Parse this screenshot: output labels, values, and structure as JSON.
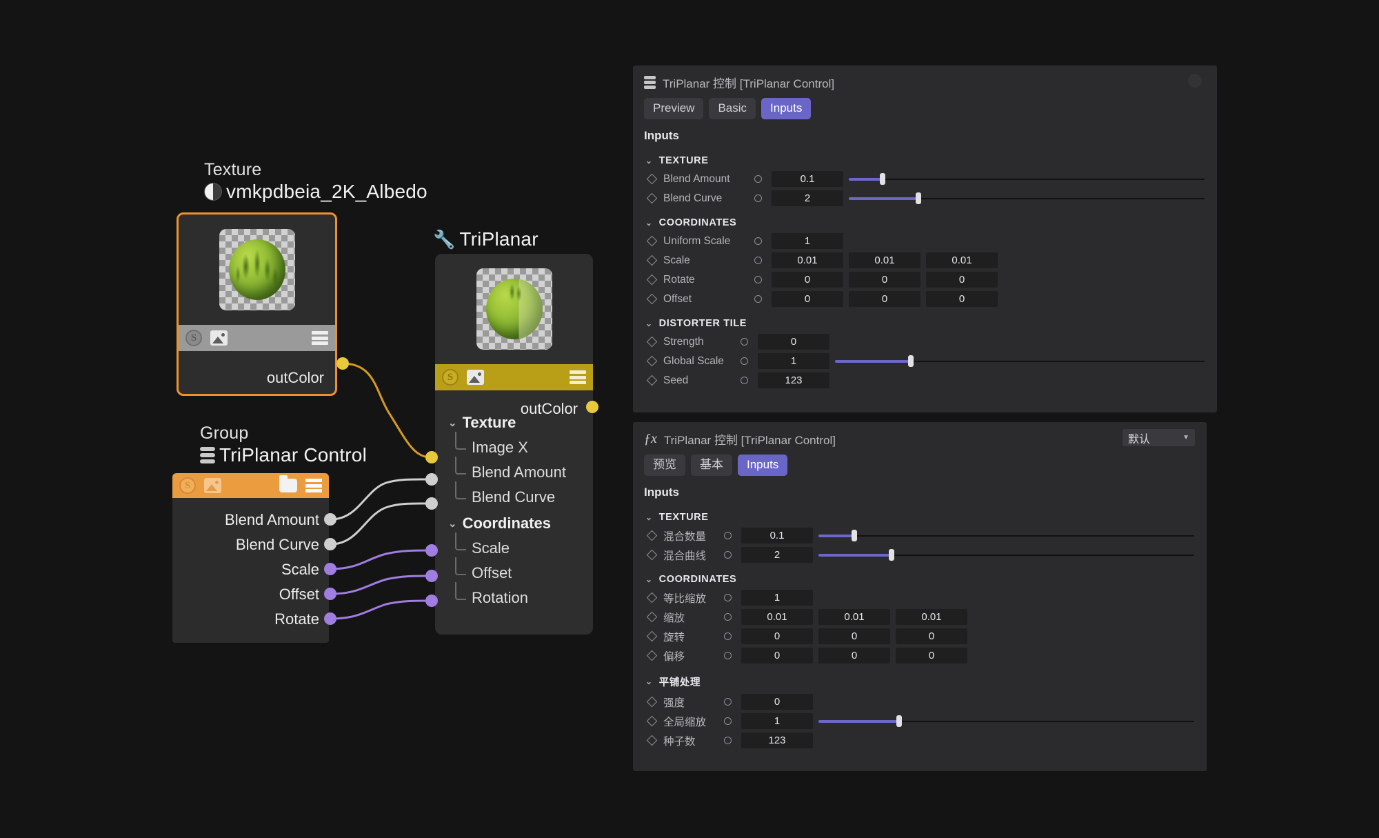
{
  "graph": {
    "texture_node": {
      "category": "Texture",
      "name": "vmkpdbeia_2K_Albedo",
      "output_label": "outColor",
      "icons": {
        "shader": "sphere-half-icon",
        "s": "s-coin-icon",
        "image": "image-icon",
        "menu": "hamburger-icon"
      }
    },
    "triplanar_node": {
      "title": "TriPlanar",
      "icon": "wrench-icon",
      "output_label": "outColor",
      "tree": [
        {
          "group": "Texture",
          "items": [
            "Image X",
            "Blend Amount",
            "Blend Curve"
          ]
        },
        {
          "group": "Coordinates",
          "items": [
            "Scale",
            "Offset",
            "Rotation"
          ]
        }
      ]
    },
    "group_node": {
      "category": "Group",
      "name": "TriPlanar Control",
      "ports": [
        "Blend Amount",
        "Blend Curve",
        "Scale",
        "Offset",
        "Rotate"
      ],
      "icons": {
        "s": "s-coin-icon",
        "image": "image-icon",
        "folder": "folder-icon",
        "menu": "hamburger-icon"
      }
    },
    "colors": {
      "selected_outline": "#f0922b",
      "group_header": "#eb9c3f",
      "triplanar_header": "#b99f18",
      "wire_yellow": "#d79a20",
      "wire_grey": "#cfcfcf",
      "wire_purple": "#a07de0"
    }
  },
  "panel_top": {
    "title": "TriPlanar 控制 [TriPlanar Control]",
    "title_icon": "node-stack-icon",
    "tabs": [
      {
        "label": "Preview",
        "active": false
      },
      {
        "label": "Basic",
        "active": false
      },
      {
        "label": "Inputs",
        "active": true
      }
    ],
    "section": "Inputs",
    "accent": "#6a66c8",
    "groups": [
      {
        "name": "TEXTURE",
        "rows": [
          {
            "label": "Blend Amount",
            "values": [
              "0.1"
            ],
            "slider": {
              "value": 0.1,
              "fill_pct": 9.5
            }
          },
          {
            "label": "Blend Curve",
            "values": [
              "2"
            ],
            "slider": {
              "value": 2,
              "fill_pct": 19.5
            }
          }
        ]
      },
      {
        "name": "COORDINATES",
        "rows": [
          {
            "label": "Uniform Scale",
            "values": [
              "1"
            ]
          },
          {
            "label": "Scale",
            "values": [
              "0.01",
              "0.01",
              "0.01"
            ]
          },
          {
            "label": "Rotate",
            "values": [
              "0",
              "0",
              "0"
            ]
          },
          {
            "label": "Offset",
            "values": [
              "0",
              "0",
              "0"
            ]
          }
        ]
      },
      {
        "name": "DISTORTER TILE",
        "rows": [
          {
            "label": "Strength",
            "values": [
              "0"
            ]
          },
          {
            "label": "Global Scale",
            "values": [
              "1"
            ],
            "slider": {
              "value": 1,
              "fill_pct": 20.5
            }
          },
          {
            "label": "Seed",
            "values": [
              "123"
            ]
          }
        ]
      }
    ]
  },
  "panel_bottom": {
    "title": "TriPlanar 控制 [TriPlanar Control]",
    "title_icon": "fx-icon",
    "preset_dropdown": {
      "value": "默认",
      "caret": "chevron-down-icon"
    },
    "tabs": [
      {
        "label": "预览",
        "active": false
      },
      {
        "label": "基本",
        "active": false
      },
      {
        "label": "Inputs",
        "active": true
      }
    ],
    "section": "Inputs",
    "groups": [
      {
        "name": "TEXTURE",
        "rows": [
          {
            "label": "混合数量",
            "values": [
              "0.1"
            ],
            "slider": {
              "value": 0.1,
              "fill_pct": 9.5
            }
          },
          {
            "label": "混合曲线",
            "values": [
              "2"
            ],
            "slider": {
              "value": 2,
              "fill_pct": 19.5
            }
          }
        ]
      },
      {
        "name": "COORDINATES",
        "rows": [
          {
            "label": "等比缩放",
            "values": [
              "1"
            ]
          },
          {
            "label": "缩放",
            "values": [
              "0.01",
              "0.01",
              "0.01"
            ]
          },
          {
            "label": "旋转",
            "values": [
              "0",
              "0",
              "0"
            ]
          },
          {
            "label": "偏移",
            "values": [
              "0",
              "0",
              "0"
            ]
          }
        ]
      },
      {
        "name": "平铺处理",
        "rows": [
          {
            "label": "强度",
            "values": [
              "0"
            ]
          },
          {
            "label": "全局缩放",
            "values": [
              "1"
            ],
            "slider": {
              "value": 1,
              "fill_pct": 21.5
            }
          },
          {
            "label": "种子数",
            "values": [
              "123"
            ]
          }
        ]
      }
    ]
  }
}
